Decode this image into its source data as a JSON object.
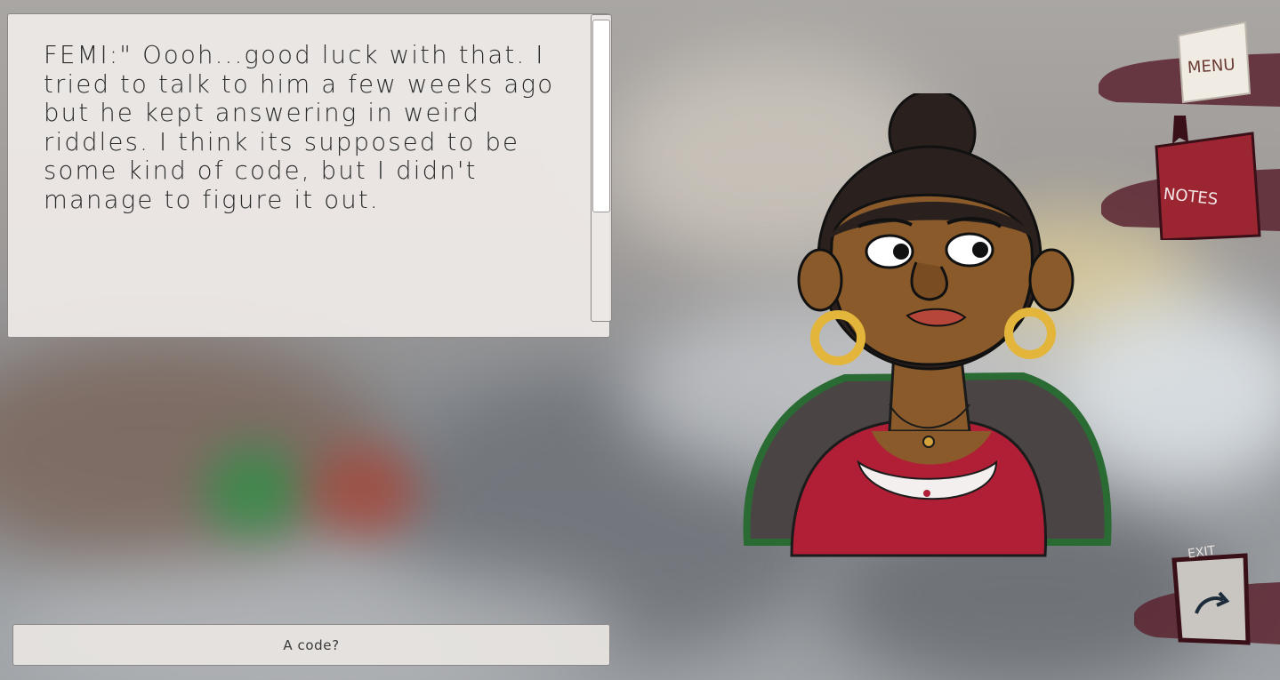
{
  "dialogue": {
    "text": "FEMI:\" Oooh...good luck with that. I tried to talk to him a few weeks ago but he kept answering in weird riddles. I think its supposed to be some kind of code, but I didn't manage to figure it out."
  },
  "reply_option": {
    "label": "A code?"
  },
  "side_menu": {
    "menu_label": "MENU",
    "notes_label": "NOTES",
    "exit_label": "EXIT"
  },
  "colors": {
    "panel_bg": "#f0ece9",
    "notebook_red": "#9b2530",
    "smear_dark": "#5a2430",
    "character_skin": "#8a5a2a",
    "character_top": "#b01f35"
  }
}
